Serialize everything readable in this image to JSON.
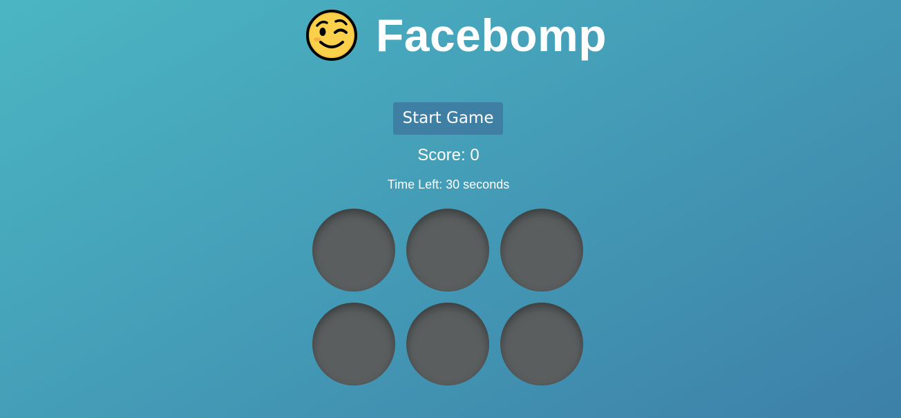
{
  "header": {
    "logo_icon": "winking-face-emoji",
    "title": "Facebomp"
  },
  "controls": {
    "start_label": "Start Game"
  },
  "status": {
    "score_label": "Score: ",
    "score_value": "0",
    "time_prefix": "Time Left: ",
    "time_value": "30",
    "time_suffix": " seconds"
  },
  "board": {
    "hole_count": 6,
    "hole_color": "#5a5e5f"
  },
  "colors": {
    "background_start": "#4bb6c3",
    "background_end": "#3d80a8",
    "button": "#3f7fa3",
    "text": "#ffffff"
  }
}
